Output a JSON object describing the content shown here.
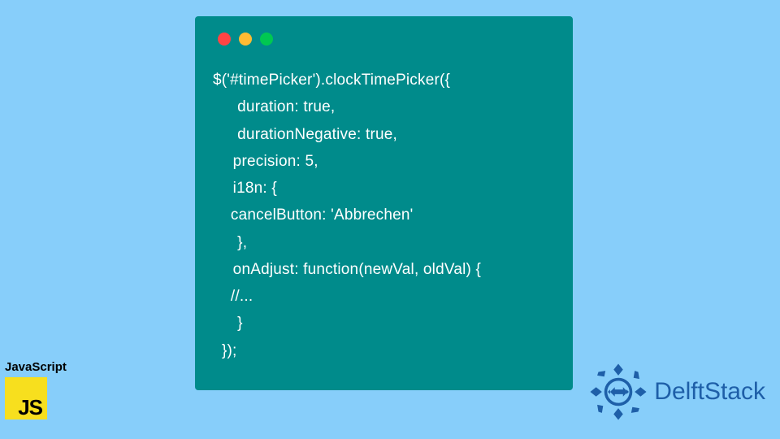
{
  "code": {
    "line1": "$('#timePicker').clockTimePicker({",
    "line2": "   duration: true,",
    "line3": "   durationNegative: true,",
    "line4": "  precision: 5,",
    "line5": "  i18n: {",
    "line6": "    cancelButton: 'Abbrechen'",
    "line7": "   },",
    "line8": "  onAdjust: function(newVal, oldVal) {",
    "line9": "    //...",
    "line10": "   }",
    "line11": "  });"
  },
  "badges": {
    "js_label": "JavaScript",
    "js_logo_text": "JS",
    "delftstack_text": "DelftStack"
  },
  "colors": {
    "background": "#87cefa",
    "code_window": "#008b8b",
    "js_yellow": "#f7df1e",
    "delftstack_blue": "#1e5fa8"
  }
}
